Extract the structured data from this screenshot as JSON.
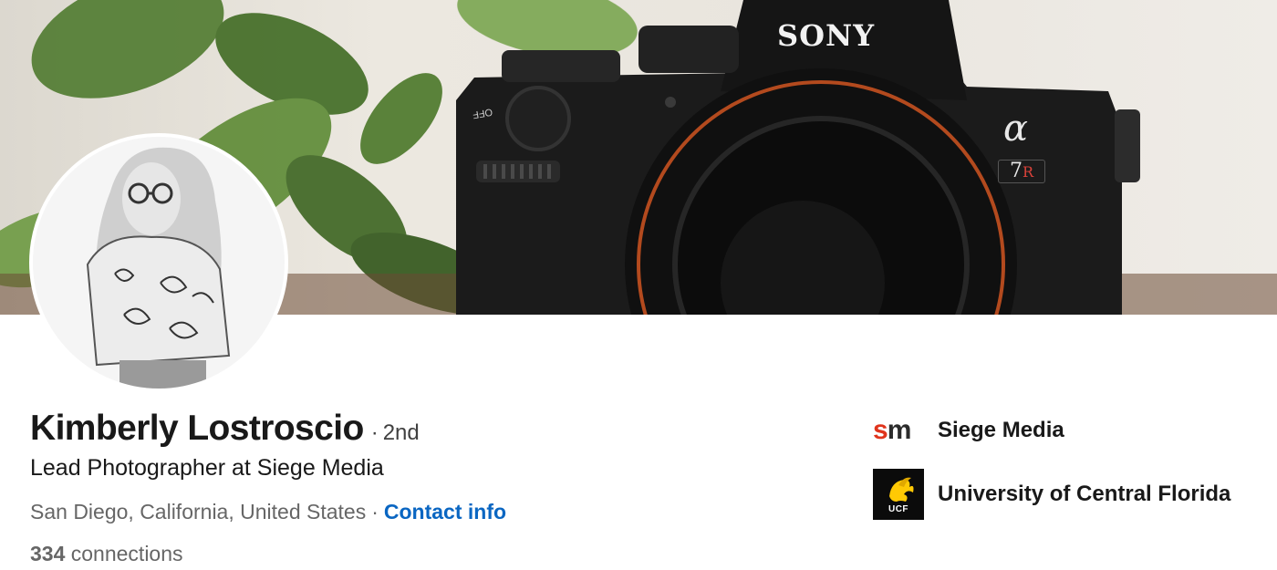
{
  "profile": {
    "name": "Kimberly Lostroscio",
    "degree_separator": "·",
    "degree": "2nd",
    "headline": "Lead Photographer at Siege Media",
    "location": "San Diego, California, United States",
    "meta_separator": "·",
    "contact_label": "Contact info",
    "connections_count": "334",
    "connections_label": "connections"
  },
  "cover": {
    "camera_brand": "SONY",
    "camera_model_alpha": "α",
    "camera_model": "7",
    "camera_model_suffix": "R",
    "dial_label": "OFF"
  },
  "organizations": [
    {
      "name": "Siege Media",
      "logo_text_s": "s",
      "logo_text_m": "m"
    },
    {
      "name": "University of Central Florida",
      "logo_text": "UCF"
    }
  ],
  "colors": {
    "link": "#0a66c2",
    "siege_red": "#e0341c",
    "ucf_gold": "#ffc904"
  }
}
